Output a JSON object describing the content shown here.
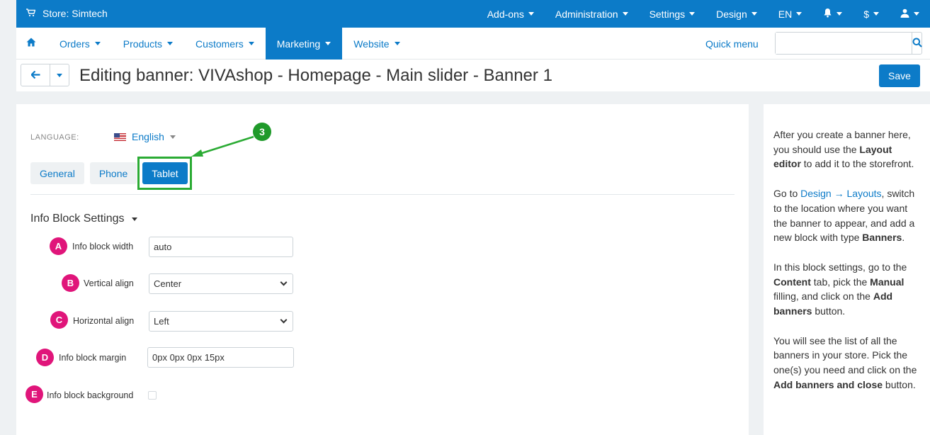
{
  "topbar": {
    "store_label": "Store: Simtech",
    "menu": [
      "Add-ons",
      "Administration",
      "Settings",
      "Design",
      "EN",
      "",
      "$",
      ""
    ]
  },
  "navbar": {
    "items": [
      "Orders",
      "Products",
      "Customers",
      "Marketing",
      "Website"
    ],
    "active": "Marketing",
    "quick_menu": "Quick menu",
    "search_value": ""
  },
  "titlebar": {
    "title": "Editing banner: VIVAshop - Homepage - Main slider - Banner 1",
    "save_label": "Save"
  },
  "form": {
    "language_label": "LANGUAGE:",
    "language_value": "English",
    "tabs": [
      "General",
      "Phone",
      "Tablet"
    ],
    "active_tab": "Tablet",
    "step_marker": "3",
    "section_title": "Info Block Settings",
    "fields": [
      {
        "badge": "A",
        "label": "Info block width",
        "value": "auto"
      },
      {
        "badge": "B",
        "label": "Vertical align",
        "value": "Center"
      },
      {
        "badge": "C",
        "label": "Horizontal align",
        "value": "Left"
      },
      {
        "badge": "D",
        "label": "Info block margin",
        "value": "0px 0px 0px 15px"
      },
      {
        "badge": "E",
        "label": "Info block background",
        "value": ""
      }
    ]
  },
  "sidebar": {
    "p1": {
      "a": "After you create a banner here, you should use the ",
      "b": "Layout editor",
      "c": " to add it to the storefront."
    },
    "p2": {
      "a": "Go to ",
      "link": "Design → Layouts",
      "b": ", switch to the location where you want the banner to appear, and add a new block with type ",
      "c": "Banners",
      "d": "."
    },
    "p3": {
      "a": "In this block settings, go to the ",
      "b": "Content",
      "c": " tab, pick the ",
      "d": "Manual",
      "e": " filling, and click on the ",
      "f": "Add banners",
      "g": " button."
    },
    "p4": {
      "a": "You will see the list of all the banners in your store. Pick the one(s) you need and click on the ",
      "b": "Add banners and close",
      "c": " button."
    }
  },
  "colors": {
    "primary": "#0c7bc8",
    "highlight": "#2bab34",
    "badge": "#e0157a"
  }
}
